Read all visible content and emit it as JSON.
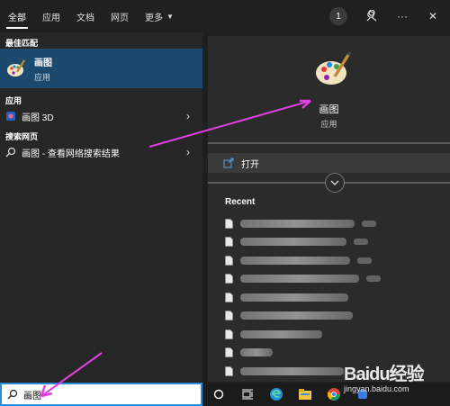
{
  "tabs": [
    {
      "label": "全部",
      "active": true
    },
    {
      "label": "应用",
      "active": false
    },
    {
      "label": "文档",
      "active": false
    },
    {
      "label": "网页",
      "active": false
    },
    {
      "label": "更多",
      "active": false
    }
  ],
  "top_right": {
    "badge": "1",
    "more": "···",
    "close": "✕"
  },
  "left": {
    "best_match_header": "最佳匹配",
    "best_match": {
      "title": "画图",
      "subtitle": "应用"
    },
    "apps_header": "应用",
    "apps": [
      {
        "label": "画图 3D"
      }
    ],
    "web_header": "搜索网页",
    "web": [
      {
        "label": "画图 - 查看网络搜索结果"
      }
    ]
  },
  "right": {
    "app_title": "画图",
    "app_subtitle": "应用",
    "open_label": "打开",
    "recent_header": "Recent",
    "recent_items": [
      {
        "width": 0.53,
        "extra": true
      },
      {
        "width": 0.49,
        "extra": true
      },
      {
        "width": 0.51,
        "extra": true
      },
      {
        "width": 0.55,
        "extra": true
      },
      {
        "width": 0.5,
        "extra": false
      },
      {
        "width": 0.52,
        "extra": false
      },
      {
        "width": 0.38,
        "extra": false
      },
      {
        "width": 0.15,
        "extra": false
      },
      {
        "width": 0.48,
        "extra": false
      },
      {
        "width": 0.46,
        "extra": false
      }
    ]
  },
  "search": {
    "value": "画图"
  },
  "watermark": {
    "brand": "Baidu经验",
    "url": "jingyan.baidu.com"
  },
  "colors": {
    "accent": "#1c4a6e",
    "search_border": "#2a8bd6",
    "annotation": "#e040e0"
  }
}
